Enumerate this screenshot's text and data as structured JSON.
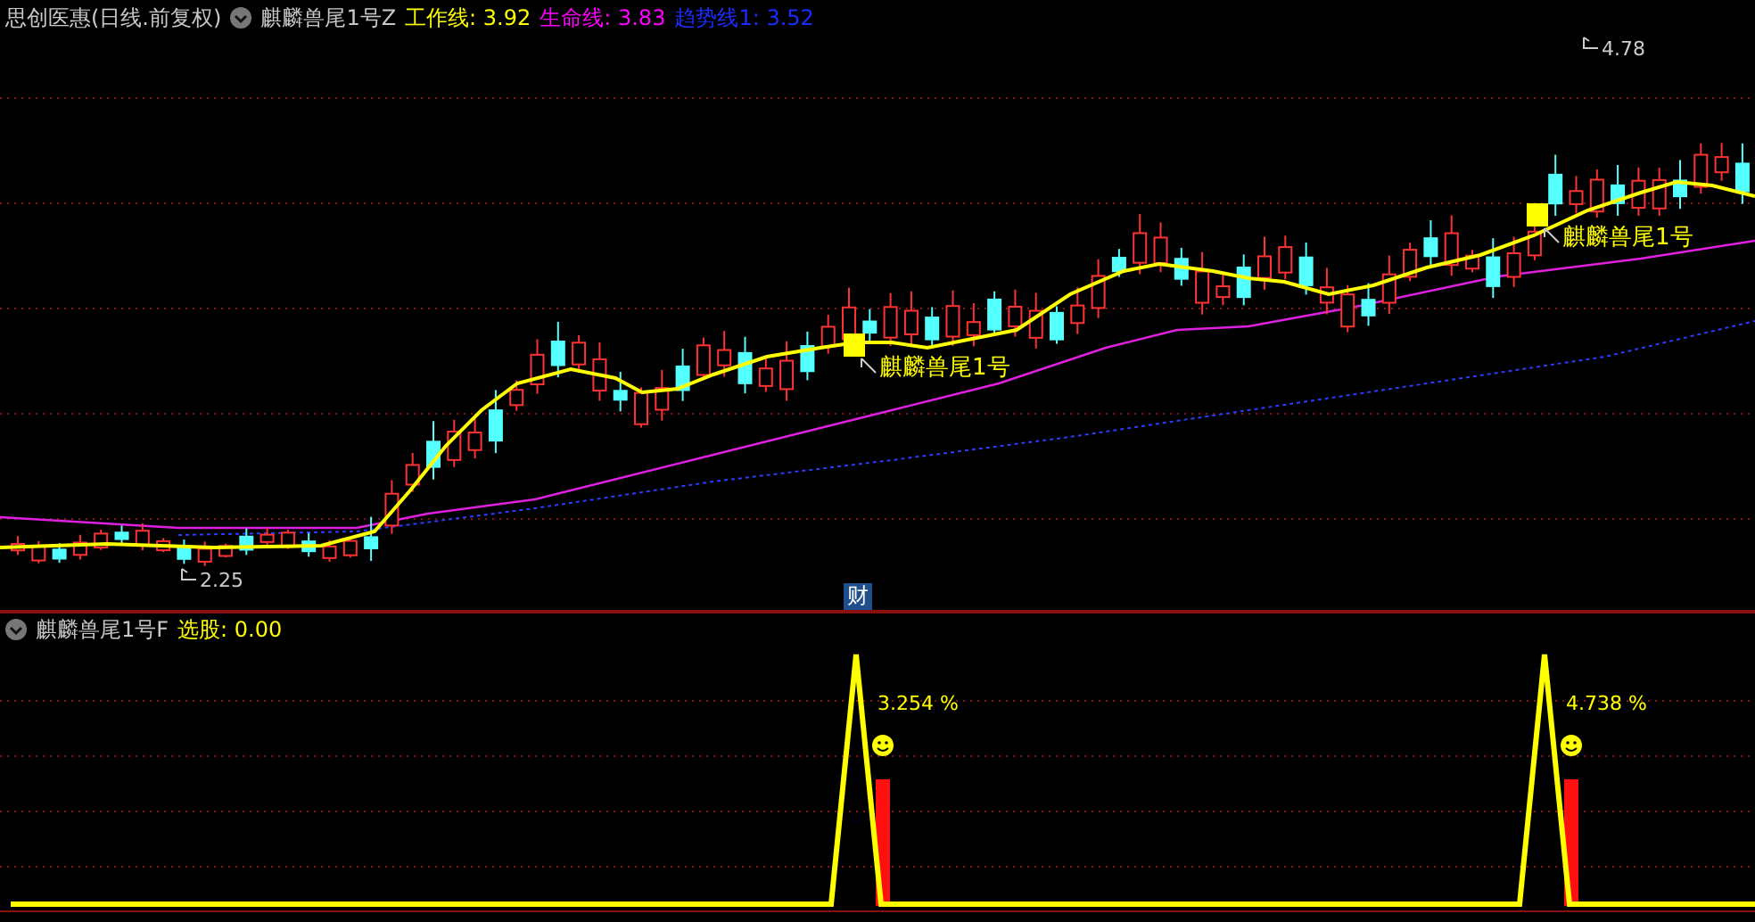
{
  "header": {
    "stock": "思创医惠(日线.前复权)",
    "indicator": "麒麟兽尾1号Z",
    "lines": [
      {
        "label": "工作线: 3.92",
        "color": "#ffff00"
      },
      {
        "label": "生命线: 3.83",
        "color": "#ff00ff"
      },
      {
        "label": "趋势线1: 3.52",
        "color": "#1a2cff"
      }
    ]
  },
  "price_chart": {
    "annotations": [
      {
        "kind": "price",
        "text": "2.25"
      },
      {
        "kind": "signal",
        "text": "麒麟兽尾1号"
      },
      {
        "kind": "signal",
        "text": "麒麟兽尾1号"
      },
      {
        "kind": "price",
        "text": "4.78"
      }
    ],
    "finance_badge": "财"
  },
  "sub_panel": {
    "title": "麒麟兽尾1号F",
    "reading": "选股: 0.00",
    "signals": [
      {
        "text": "3.254 %"
      },
      {
        "text": "4.738 %"
      }
    ]
  }
}
